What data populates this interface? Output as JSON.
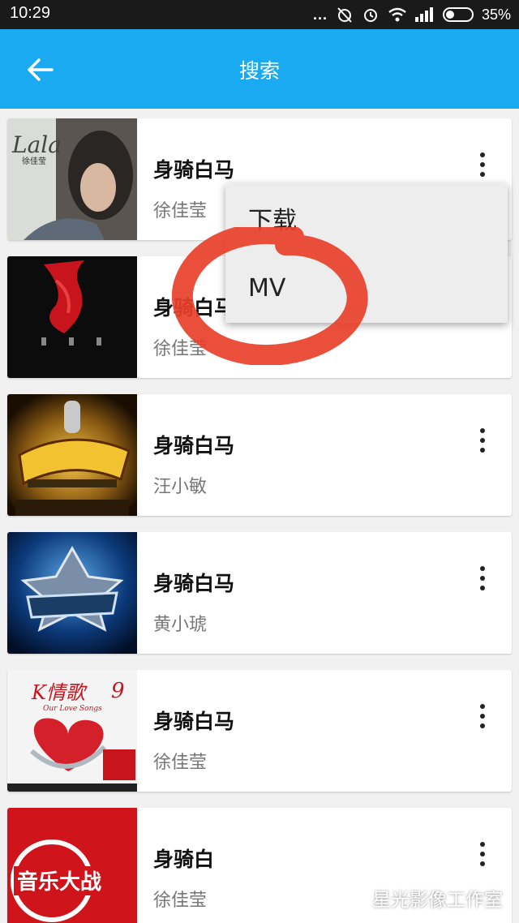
{
  "status_bar": {
    "time": "10:29",
    "dots": "...",
    "battery": "35%"
  },
  "app_bar": {
    "back_icon": "arrow-left-icon",
    "title": "搜索"
  },
  "songs": [
    {
      "title": "身骑白马",
      "artist": "徐佳莹",
      "cover_icon": "album-cover-lala"
    },
    {
      "title": "身骑白马",
      "artist": "徐佳莹",
      "cover_icon": "album-cover-red"
    },
    {
      "title": "身骑白马",
      "artist": "汪小敏",
      "cover_icon": "album-cover-show"
    },
    {
      "title": "身骑白马",
      "artist": "黄小琥",
      "cover_icon": "album-cover-star"
    },
    {
      "title": "身骑白马",
      "artist": "徐佳莹",
      "cover_icon": "album-cover-heart"
    },
    {
      "title": "身骑白",
      "artist": "徐佳莹",
      "cover_icon": "album-cover-music-battle"
    }
  ],
  "cover_text": {
    "lala": "Lala",
    "lala_sub": "徐佳莹",
    "heart_k": "K情歌",
    "heart_num": "9",
    "heart_en": "Our Love Songs",
    "battle": "音乐大战"
  },
  "popup_menu": {
    "items": [
      "下载",
      "MV"
    ]
  },
  "watermark": {
    "text": "星光影像工作室"
  },
  "colors": {
    "app_bar": "#1aaaf2",
    "status_bar": "#1a1a1a",
    "annotation_circle": "#e8402a"
  }
}
